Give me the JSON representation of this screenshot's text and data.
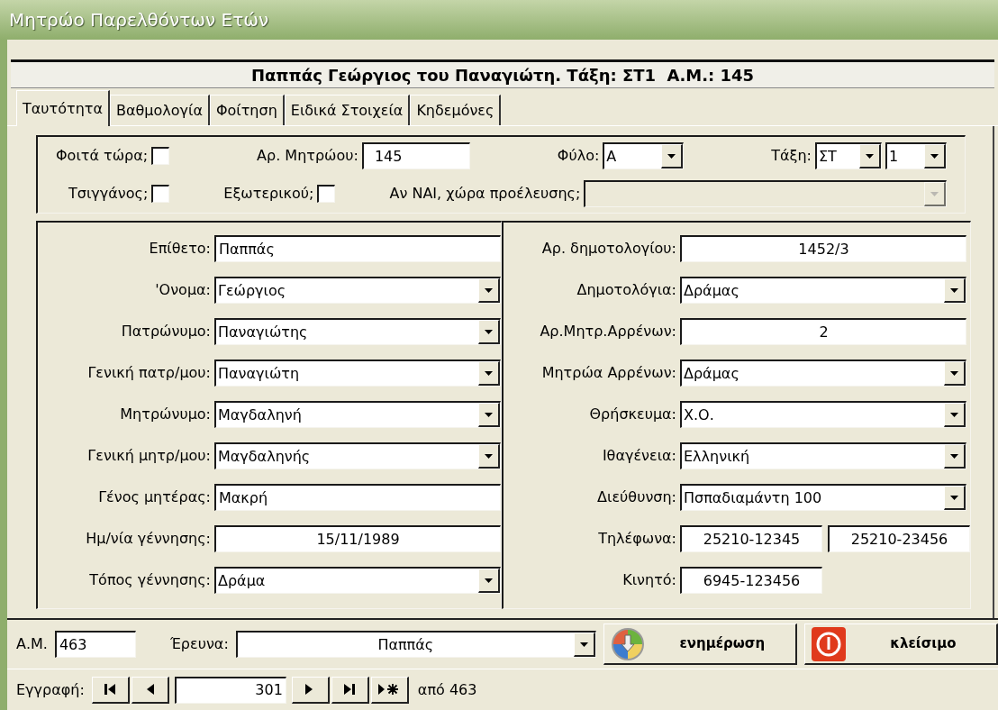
{
  "window": {
    "title": "Μητρώο Παρελθόντων Ετών"
  },
  "header": "Παππάς Γεώργιος του Παναγιώτη. Τάξη: ΣΤ1  Α.Μ.: 145",
  "tabs": [
    {
      "label": "Ταυτότητα",
      "selected": true
    },
    {
      "label": "Βαθμολογία",
      "selected": false
    },
    {
      "label": "Φοίτηση",
      "selected": false
    },
    {
      "label": "Ειδικά Στοιχεία",
      "selected": false
    },
    {
      "label": "Κηδεμόνες",
      "selected": false
    }
  ],
  "general": {
    "rows": [
      [
        {
          "kind": "checkbox",
          "label": "Φοιτά τώρα;",
          "checked": false
        },
        {
          "kind": "text",
          "label": "Αρ. Μητρώου:",
          "value": "145"
        },
        {
          "kind": "combo",
          "label": "Φύλο:",
          "value": "Α",
          "disabled": false
        },
        {
          "kind": "combo_pair",
          "label": "Τάξη:",
          "values": [
            "ΣΤ",
            "1"
          ]
        }
      ],
      [
        {
          "kind": "checkbox",
          "label": "Τσιγγάνος;",
          "checked": false
        },
        {
          "kind": "checkbox",
          "label": "Εξωτερικού;",
          "checked": false
        },
        {
          "kind": "combo",
          "label": "Αν ΝΑΙ, χώρα προέλευσης;",
          "disabled": true
        }
      ]
    ]
  },
  "personal": [
    {
      "kind": "text",
      "label": "Επίθετο:",
      "value": "Παππάς"
    },
    {
      "kind": "combo",
      "label": "'Ονομα:",
      "value": "Γεώργιος"
    },
    {
      "kind": "combo",
      "label": "Πατρώνυμο:",
      "value": "Παναγιώτης"
    },
    {
      "kind": "combo",
      "label": "Γενική πατρ/μου:",
      "value": "Παναγιώτη"
    },
    {
      "kind": "combo",
      "label": "Μητρώνυμο:",
      "value": "Μαγδαληνή"
    },
    {
      "kind": "combo",
      "label": "Γενική μητρ/μου:",
      "value": "Μαγδαληνής"
    },
    {
      "kind": "text",
      "label": "Γένος μητέρας:",
      "value": "Μακρή"
    },
    {
      "kind": "centered",
      "label": "Ημ/νία γέννησης:",
      "value": "15/11/1989"
    },
    {
      "kind": "combo",
      "label": "Τόπος γέννησης:",
      "value": "Δράμα"
    }
  ],
  "civic": [
    {
      "kind": "centered",
      "label": "Αρ. δημοτολογίου:",
      "value": "1452/3"
    },
    {
      "kind": "combo",
      "label": "Δημοτολόγια:",
      "value": "Δράμας"
    },
    {
      "kind": "centered",
      "label": "Αρ.Μητρ.Αρρένων:",
      "value": "2"
    },
    {
      "kind": "combo",
      "label": "Μητρώα Αρρένων:",
      "value": "Δράμας"
    },
    {
      "kind": "combo",
      "label": "Θρήσκευμα:",
      "value": "Χ.Ο."
    },
    {
      "kind": "combo",
      "label": "Ιθαγένεια:",
      "value": "Ελληνική"
    },
    {
      "kind": "combo",
      "label": "Διεύθυνση:",
      "value": "Πσπαδιαμάντη 100"
    },
    {
      "kind": "pair",
      "label": "Τηλέφωνα:",
      "values": [
        "25210-12345",
        "25210-23456"
      ]
    },
    {
      "kind": "short",
      "label": "Κινητό:",
      "value": "6945-123456"
    }
  ],
  "search": {
    "id_label": "Α.Μ.",
    "id_value": "463",
    "search_label": "Έρευνα:",
    "search_value": "Παππάς"
  },
  "actions": [
    {
      "kind": "update",
      "label": "ενημέρωση"
    },
    {
      "kind": "close",
      "label": "κλείσιμο"
    }
  ],
  "navigation": {
    "label": "Εγγραφή:",
    "current": "301",
    "total": "από 463"
  }
}
